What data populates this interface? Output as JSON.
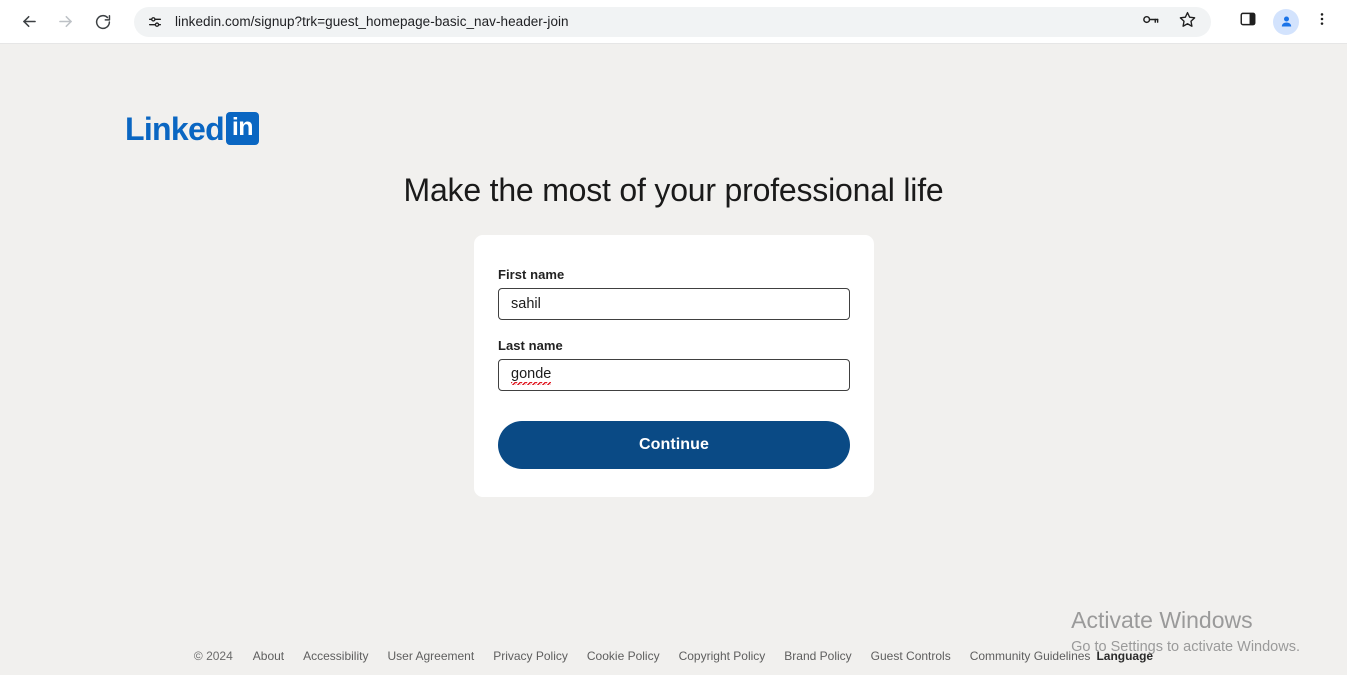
{
  "browser": {
    "back_icon": "back-arrow-icon",
    "forward_icon": "forward-arrow-icon",
    "reload_icon": "reload-icon",
    "site_settings_icon": "site-settings-tune-icon",
    "url": "linkedin.com/signup?trk=guest_homepage-basic_nav-header-join",
    "url_placeholder": "Search Google or type a URL",
    "password_icon": "password-key-icon",
    "bookmark_icon": "bookmark-star-icon",
    "side_panel_icon": "side-panel-icon",
    "profile_icon": "profile-avatar-icon",
    "menu_icon": "three-dot-menu-icon"
  },
  "page": {
    "brand": {
      "word": "Linked",
      "box_text": "in",
      "color": "#0a66c2"
    },
    "headline": "Make the most of your professional life",
    "form": {
      "first_name": {
        "label": "First name",
        "value": "sahil",
        "placeholder": ""
      },
      "last_name": {
        "label": "Last name",
        "value": "gonde",
        "placeholder": "",
        "misspelled": true
      },
      "submit_label": "Continue",
      "submit_color": "#0a4a85"
    },
    "watermark": {
      "title": "Activate Windows",
      "subtitle": "Go to Settings to activate Windows."
    },
    "footer": {
      "copyright": "© 2024",
      "links": [
        "About",
        "Accessibility",
        "User Agreement",
        "Privacy Policy",
        "Cookie Policy",
        "Copyright Policy",
        "Brand Policy",
        "Guest Controls",
        "Community Guidelines"
      ],
      "language": "Language"
    }
  }
}
